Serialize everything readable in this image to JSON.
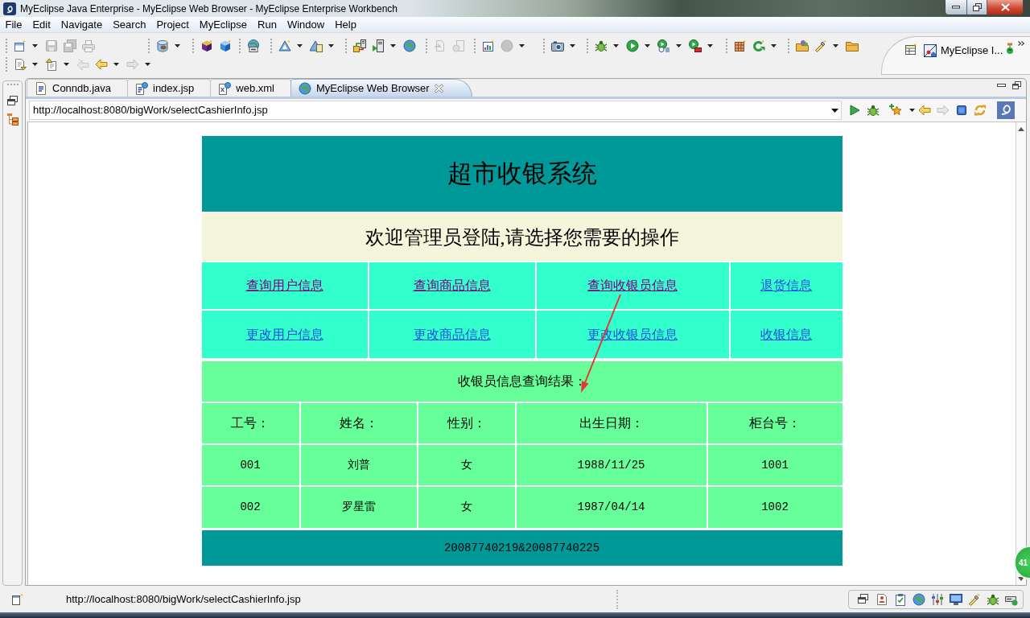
{
  "window": {
    "title": "MyEclipse Java Enterprise - MyEclipse Web Browser - MyEclipse Enterprise Workbench"
  },
  "menu": [
    "File",
    "Edit",
    "Navigate",
    "Search",
    "Project",
    "MyEclipse",
    "Run",
    "Window",
    "Help"
  ],
  "toolbar": {
    "rows": [
      {
        "groups": [
          {
            "buttons": [
              {
                "disabled": false
              },
              {
                "disabled": true
              },
              {
                "disabled": true
              },
              {
                "disabled": true
              }
            ]
          },
          {
            "buttons": [
              {
                "disabled": false
              }
            ]
          },
          {
            "buttons": [
              {
                "disabled": false
              },
              {
                "disabled": false
              }
            ]
          },
          {
            "buttons": [
              {
                "disabled": false
              }
            ]
          },
          {
            "buttons": [
              {
                "disabled": false
              },
              {
                "disabled": false
              }
            ]
          },
          {
            "buttons": [
              {
                "disabled": false
              },
              {
                "disabled": false
              },
              {
                "disabled": false
              }
            ]
          },
          {
            "buttons": [
              {
                "disabled": true
              },
              {
                "disabled": true
              }
            ]
          },
          {
            "buttons": [
              {
                "disabled": false
              },
              {
                "disabled": true
              }
            ]
          },
          {
            "buttons": [
              {
                "disabled": false
              }
            ]
          },
          {
            "buttons": [
              {
                "disabled": false
              },
              {
                "disabled": false
              },
              {
                "disabled": false
              },
              {
                "disabled": false
              }
            ]
          },
          {
            "buttons": [
              {
                "disabled": false
              },
              {
                "disabled": false
              }
            ]
          },
          {
            "buttons": [
              {
                "disabled": false
              },
              {
                "disabled": false
              },
              {
                "disabled": false
              }
            ]
          }
        ]
      },
      {
        "groups": [
          {
            "buttons": [
              {
                "disabled": false
              },
              {
                "disabled": false
              },
              {
                "disabled": true
              },
              {
                "disabled": false
              },
              {
                "disabled": true
              }
            ]
          }
        ]
      }
    ]
  },
  "perspective": {
    "label": "MyEclipse I..."
  },
  "editor_tabs": [
    {
      "label": "Conndb.java",
      "kind": "java",
      "selected": false
    },
    {
      "label": "index.jsp",
      "kind": "jsp",
      "selected": false
    },
    {
      "label": "web.xml",
      "kind": "xml",
      "selected": false
    },
    {
      "label": "MyEclipse Web Browser",
      "kind": "browser",
      "selected": true
    }
  ],
  "address_bar": {
    "value": "http://localhost:8080/bigWork/selectCashierInfo.jsp"
  },
  "browser_toolbar": [
    {
      "disabled": false
    },
    {
      "disabled": false
    },
    {
      "disabled": false
    },
    {
      "disabled": false
    },
    {
      "disabled": true
    },
    {
      "disabled": false
    },
    {
      "disabled": false
    }
  ],
  "page": {
    "title": "超市收银系统",
    "welcome": "欢迎管理员登陆,请选择您需要的操作",
    "nav_links": [
      [
        {
          "label": "查询用户信息",
          "visited": true
        },
        {
          "label": "查询商品信息",
          "visited": true
        },
        {
          "label": "查询收银员信息",
          "visited": true
        },
        {
          "label": "退货信息",
          "visited": false
        }
      ],
      [
        {
          "label": "更改用户信息",
          "visited": false
        },
        {
          "label": "更改商品信息",
          "visited": false
        },
        {
          "label": "更改收银员信息",
          "visited": false
        },
        {
          "label": "收银信息",
          "visited": false
        }
      ]
    ],
    "result": {
      "caption": "收银员信息查询结果：",
      "columns": [
        "工号：",
        "姓名：",
        "性别：",
        "出生日期：",
        "柜台号："
      ],
      "rows": [
        [
          "001",
          "刘普",
          "女",
          "1988/11/25",
          "1001"
        ],
        [
          "002",
          "罗星雷",
          "女",
          "1987/04/14",
          "1002"
        ]
      ]
    },
    "footer": "20087740219&20087740225"
  },
  "status_bar": {
    "url": "http://localhost:8080/bigWork/selectCashierInfo.jsp"
  },
  "floating_widget": {
    "label": "41"
  }
}
